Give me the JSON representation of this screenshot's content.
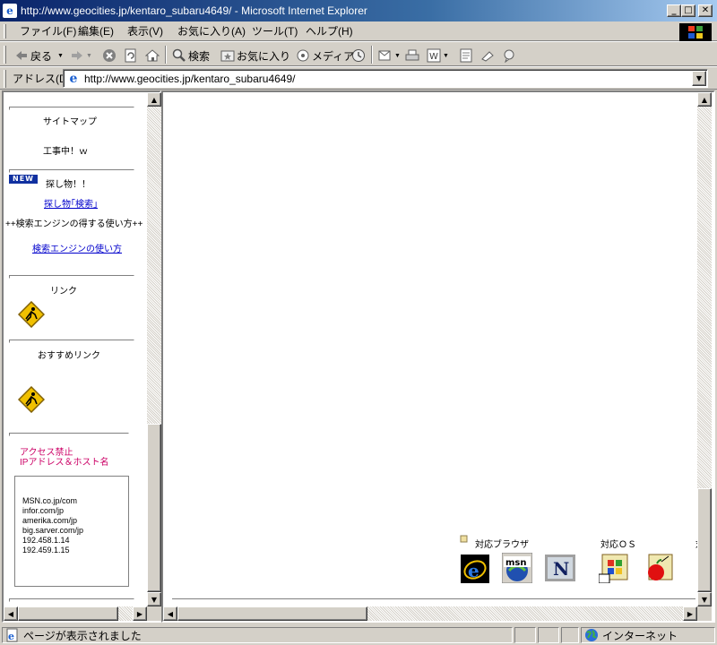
{
  "window": {
    "title": "http://www.geocities.jp/kentaro_subaru4649/ - Microsoft Internet Explorer",
    "min_label": "_",
    "max_label": "□",
    "close_label": "✕"
  },
  "menu": [
    "ファイル(F)",
    "編集(E)",
    "表示(V)",
    "お気に入り(A)",
    "ツール(T)",
    "ヘルプ(H)"
  ],
  "toolbar": {
    "back_label": "戻る",
    "search_label": "検索",
    "favorites_label": "お気に入り",
    "media_label": "メディア"
  },
  "address": {
    "label": "アドレス(D)",
    "url": "http://www.geocities.jp/kentaro_subaru4649/"
  },
  "sidebar": {
    "sitemap": "サイトマップ",
    "under_construction": "工事中！ｗ",
    "new_badge": "NEW",
    "search_title": "探し物！！",
    "search_link": "探し物｢検索｣",
    "search_engine_tips": "++検索エンジンの得する使い方++",
    "search_engine_link": "検索エンジンの使い方",
    "links_title": "リンク",
    "recommended_title": "おすすめリンク",
    "access_denied_1": "アクセス禁止",
    "access_denied_2": "IPアドレス＆ホスト名",
    "blocked_hosts": [
      "MSN.co.jp/com",
      "infor.com/jp",
      "amerika.com/jp",
      "big.sarver.com/jp",
      "192.458.1.14",
      "192.459.1.15"
    ]
  },
  "main": {
    "browsers_label": "対応ブラウザ",
    "os_label": "対応ＯＳ",
    "truncated_label": "対"
  },
  "browser_icons": [
    "ie-icon",
    "msn-icon",
    "netscape-icon"
  ],
  "os_icons": [
    "windows-icon",
    "mac-icon"
  ],
  "status": {
    "message": "ページが表示されました",
    "zone": "インターネット"
  },
  "colors": {
    "title_start": "#0a246a",
    "title_end": "#a6caf0",
    "link": "#0000cc",
    "access_denied": "#cc0066",
    "chrome": "#d4d0c8"
  }
}
